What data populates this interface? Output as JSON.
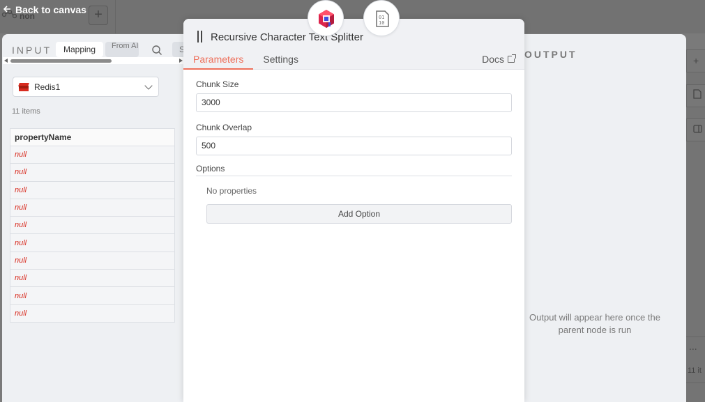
{
  "back_label": "Back to canvas",
  "bg_node_label": "non",
  "input": {
    "title": "INPUT",
    "tabs": [
      {
        "label": "Mapping",
        "active": true
      },
      {
        "label": "From AI",
        "active": false
      },
      {
        "label": "S",
        "active": false
      }
    ],
    "node_select_value": "Redis1",
    "items_count": "11 items",
    "table": {
      "header": "propertyName",
      "rows": [
        "null",
        "null",
        "null",
        "null",
        "null",
        "null",
        "null",
        "null",
        "null",
        "null"
      ]
    }
  },
  "modal": {
    "title": "Recursive Character Text Splitter",
    "tabs": [
      {
        "label": "Parameters",
        "active": true
      },
      {
        "label": "Settings",
        "active": false
      }
    ],
    "docs_label": "Docs",
    "chunk_size_label": "Chunk Size",
    "chunk_size_value": "3000",
    "chunk_overlap_label": "Chunk Overlap",
    "chunk_overlap_value": "500",
    "options_label": "Options",
    "no_properties": "No properties",
    "add_option_label": "Add Option"
  },
  "output": {
    "title": "OUTPUT",
    "empty_message": "Output will appear here once the parent node is run"
  },
  "right_strip": {
    "more": "...",
    "count": "11 it"
  },
  "colors": {
    "accent": "#ee6f5a",
    "null_text": "#d82c20",
    "panel_bg": "#eef0f3"
  }
}
